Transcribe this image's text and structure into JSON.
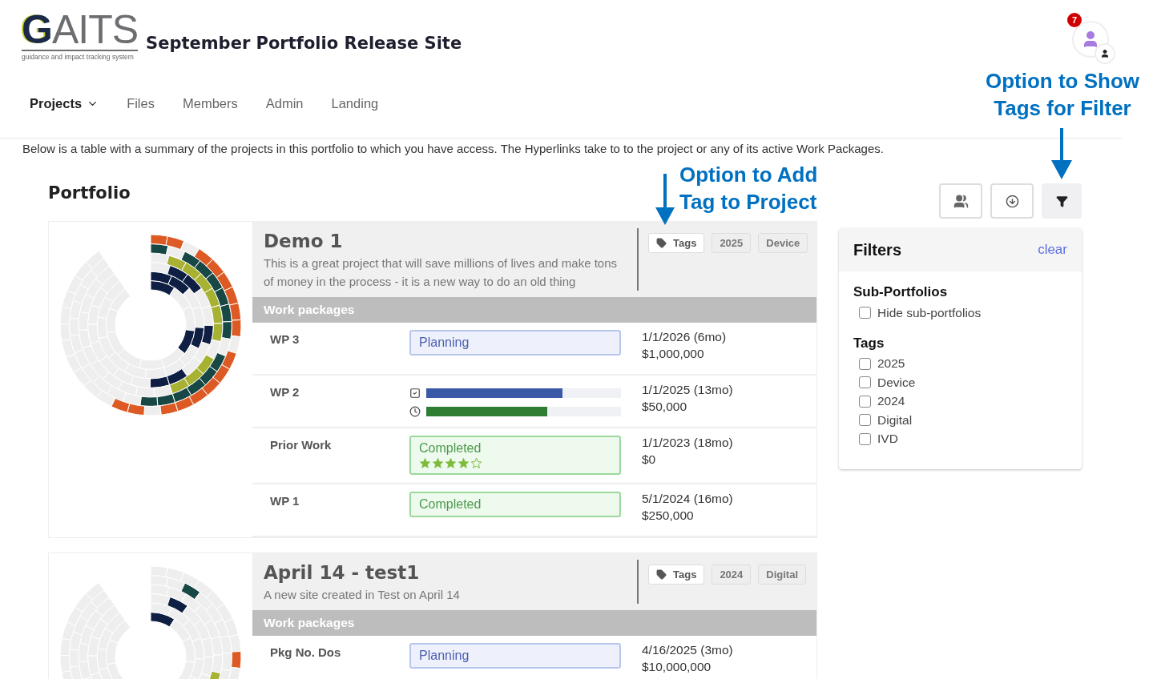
{
  "header": {
    "logo": "**G**AITS",
    "logo_tagline": "guidance and impact tracking system",
    "site_title": "September Portfolio Release Site",
    "notification_count": "7"
  },
  "nav": [
    {
      "label": "Projects",
      "selected": true,
      "dropdown": true
    },
    {
      "label": "Files",
      "selected": false,
      "dropdown": false
    },
    {
      "label": "Members",
      "selected": false,
      "dropdown": false
    },
    {
      "label": "Admin",
      "selected": false,
      "dropdown": false
    },
    {
      "label": "Landing",
      "selected": false,
      "dropdown": false
    }
  ],
  "intro": "Below is a table with a summary of the projects in this portfolio to which you have access. The Hyperlinks take to to the project or any of its active Work Packages.",
  "portfolio": {
    "title": "Portfolio",
    "projects": [
      {
        "title": "Demo 1",
        "description": "This is a great project that will save millions of lives and make tons of money in the process - it is a new way to do an old thing",
        "tags_button": "Tags",
        "tags": [
          "2025",
          "Device"
        ],
        "work_packages_label": "Work packages",
        "packages": [
          {
            "name": "WP 3",
            "kind": "planning",
            "status": {
              "label": "Planning"
            },
            "date": "1/1/2026 (6mo)",
            "budget": "$1,000,000"
          },
          {
            "name": "WP 2",
            "kind": "progress",
            "bars": [
              {
                "kind": "tasks",
                "level": 0.7
              },
              {
                "kind": "time",
                "level": 0.62
              }
            ],
            "date": "1/1/2025 (13mo)",
            "budget": "$50,000"
          },
          {
            "name": "Prior Work",
            "kind": "completed",
            "status": {
              "label": "Completed",
              "stars": 4
            },
            "date": "1/1/2023 (18mo)",
            "budget": "$0"
          },
          {
            "name": "WP 1",
            "kind": "completed",
            "status": {
              "label": "Completed"
            },
            "date": "5/1/2024 (16mo)",
            "budget": "$250,000"
          }
        ]
      },
      {
        "title": "April 14 - test1",
        "description": "A new site created in Test on April 14",
        "tags_button": "Tags",
        "tags": [
          "2024",
          "Digital"
        ],
        "work_packages_label": "Work packages",
        "packages": [
          {
            "name": "Pkg No. Dos",
            "kind": "planning",
            "status": {
              "label": "Planning"
            },
            "date": "4/16/2025 (3mo)",
            "budget": "$10,000,000"
          }
        ]
      }
    ]
  },
  "toolbar": [
    {
      "kind": "members",
      "selected": false
    },
    {
      "kind": "download",
      "selected": false
    },
    {
      "kind": "filter",
      "selected": true
    }
  ],
  "filters": {
    "title": "Filters",
    "clear": "clear",
    "sections": [
      {
        "title": "Sub-Portfolios",
        "options": [
          {
            "label": "Hide sub-portfolios",
            "checked": false
          }
        ]
      },
      {
        "title": "Tags",
        "options": [
          {
            "label": "2025",
            "checked": false
          },
          {
            "label": "Device",
            "checked": false
          },
          {
            "label": "2024",
            "checked": false
          },
          {
            "label": "Digital",
            "checked": false
          },
          {
            "label": "IVD",
            "checked": false
          }
        ]
      }
    ]
  },
  "annotations": [
    {
      "text": "Option to Add Tag to Project"
    },
    {
      "text": "Option to Show Tags for Filter"
    }
  ]
}
